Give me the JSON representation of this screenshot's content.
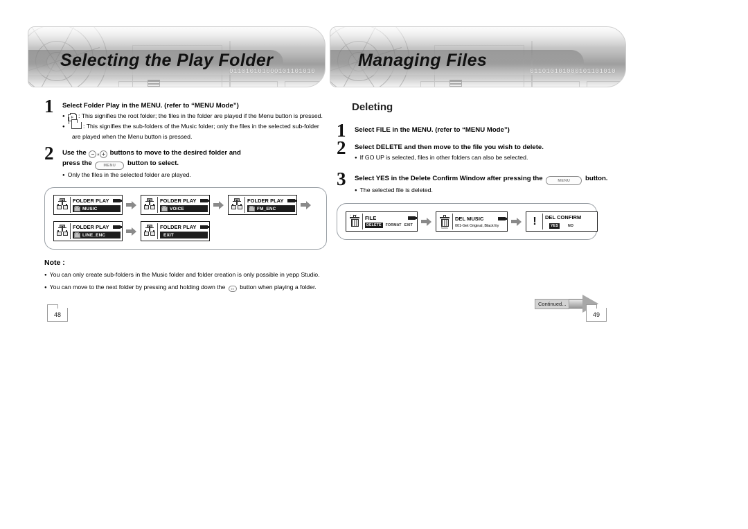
{
  "headers": {
    "left_title": "Selecting the Play Folder",
    "right_title": "Managing Files",
    "binary_strip": "011010101000101101010"
  },
  "left": {
    "step1": {
      "number": "1",
      "heading": "Select Folder Play in the MENU. (refer to “MENU Mode”)",
      "root_icon_label": "F",
      "bullet1": ": This signifies the root folder; the files in the folder are played if the Menu button is pressed.",
      "bullet2": ": This signifies the sub-folders of the Music folder; only the files in the selected sub-folder",
      "bullet2_cont": "are played when the Menu button is pressed."
    },
    "step2": {
      "number": "2",
      "head_a": "Use the",
      "minus_key": "−",
      "plus_key": "+",
      "head_b": "buttons to move to the desired folder and",
      "head_c": "press the",
      "menu_key": "MENU",
      "head_d": "button to select.",
      "bullet": "Only the files in the selected folder are played."
    },
    "flow": {
      "title": "FOLDER PLAY",
      "rows": [
        [
          {
            "title": "FOLDER PLAY",
            "value": "MUSIC",
            "folder": true
          },
          {
            "title": "FOLDER PLAY",
            "value": "VOICE",
            "folder": true
          },
          {
            "title": "FOLDER PLAY",
            "value": "FM_ENC",
            "folder": true
          }
        ],
        [
          {
            "title": "FOLDER PLAY",
            "value": "LINE_ENC",
            "folder": true
          },
          {
            "title": "FOLDER PLAY",
            "value": "EXIT",
            "folder": false
          }
        ]
      ]
    },
    "note": {
      "title": "Note :",
      "line1": "You can only create sub-folders in the Music folder and folder creation is only possible in yepp Studio.",
      "line2_a": "You can move to the next folder by pressing and holding down the",
      "line2_b": "button when playing a folder."
    },
    "page_number": "48"
  },
  "right": {
    "section_title": "Deleting",
    "step1": {
      "number": "1",
      "heading": "Select FILE in the MENU. (refer to “MENU Mode”)"
    },
    "step2": {
      "number": "2",
      "heading": "Select DELETE and then move to the file you wish to delete.",
      "bullet": "If GO UP is selected, files in other folders can also be selected."
    },
    "step3": {
      "number": "3",
      "head_a": "Select YES in the Delete Confirm Window after pressing the",
      "menu_key": "MENU",
      "head_b": "button.",
      "bullet": "The selected file is deleted."
    },
    "flow": {
      "screen1": {
        "title": "FILE",
        "menu_selected": "DELETE",
        "menu_items": [
          "FORMAT",
          "EXIT"
        ]
      },
      "screen2": {
        "title": "DEL MUSIC",
        "filename": "001-Get Original, Black Ey",
        "icon_label": "MUSIC"
      },
      "screen3": {
        "title": "DEL CONFIRM",
        "yes": "YES",
        "no": "NO"
      }
    },
    "continued_label": "Continued...",
    "page_number": "49"
  }
}
